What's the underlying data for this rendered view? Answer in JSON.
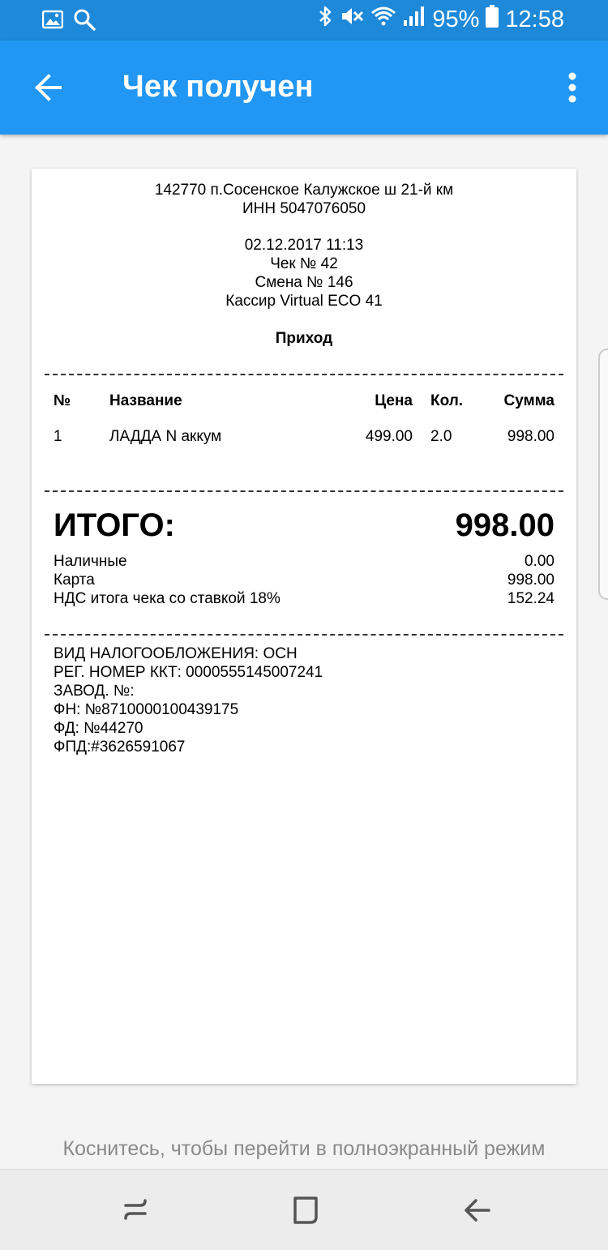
{
  "status_bar": {
    "battery_percent": "95%",
    "time": "12:58"
  },
  "app_bar": {
    "title": "Чек получен"
  },
  "receipt": {
    "address": "142770 п.Сосенское Калужское ш 21-й км",
    "inn": "ИНН 5047076050",
    "datetime": "02.12.2017 11:13",
    "check_number": "Чек № 42",
    "shift": "Смена № 146",
    "cashier": "Кассир Virtual ECO 41",
    "operation": "Приход",
    "columns": {
      "num": "№",
      "name": "Название",
      "price": "Цена",
      "qty": "Кол.",
      "sum": "Сумма"
    },
    "items": [
      {
        "num": "1",
        "name": "ЛАДДА N аккум",
        "price": "499.00",
        "qty": "2.0",
        "sum": "998.00"
      }
    ],
    "total_label": "ИТОГО:",
    "total_value": "998.00",
    "payments": [
      {
        "label": "Наличные",
        "value": "0.00"
      },
      {
        "label": "Карта",
        "value": "998.00"
      },
      {
        "label": "НДС итога чека со ставкой 18%",
        "value": "152.24"
      }
    ],
    "footer": [
      "ВИД НАЛОГООБЛОЖЕНИЯ: ОСН",
      "РЕГ. НОМЕР ККТ: 0000555145007241",
      "ЗАВОД. №:",
      "ФН: №8710000100439175",
      "ФД: №44270",
      "ФПД:#3626591067"
    ]
  },
  "hint": "Коснитесь, чтобы перейти в полноэкранный режим"
}
